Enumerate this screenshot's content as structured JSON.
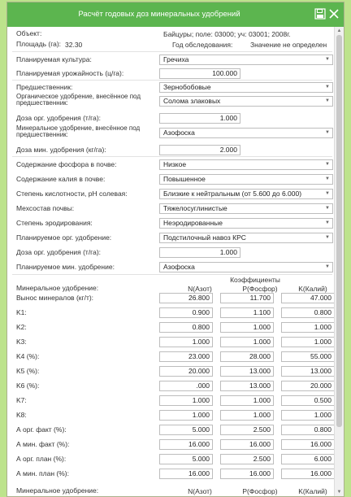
{
  "window": {
    "title": "Расчёт годовых доз минеральных удобрений"
  },
  "info": {
    "object_label": "Объект:",
    "object_value": "Байцуры; поле: 03000; уч: 03001; 2008г.",
    "area_label": "Площадь (га):",
    "area_value": "32.30",
    "survey_label": "Год обследования:",
    "survey_value": "Значение не определен"
  },
  "form": {
    "crop_label": "Планируемая культура:",
    "crop_value": "Гречиха",
    "yield_label": "Планируемая урожайность (ц/га):",
    "yield_value": "100.000",
    "pred_label": "Предшественник:",
    "pred_value": "Зернобобовые",
    "org_pred_label": "Органическое удобрение, внесённое под предшественник:",
    "org_pred_value": "Солома злаковых",
    "org_dose_label": "Доза орг. удобрения (т/га):",
    "org_dose_value": "1.000",
    "min_pred_label": "Минеральное удобрение, внесённое под предшественник:",
    "min_pred_value": "Азофоска",
    "min_dose_label": "Доза мин. удобрения (кг/га):",
    "min_dose_value": "2.000",
    "phos_label": "Содержание фосфора в почве:",
    "phos_value": "Низкое",
    "pot_label": "Содержание калия в почве:",
    "pot_value": "Повышенное",
    "ph_label": "Степень кислотности, pH солевая:",
    "ph_value": "Близкие к нейтральным (от 5.600 до 6.000)",
    "mech_label": "Мехсостав почвы:",
    "mech_value": "Тяжелосуглинистые",
    "eros_label": "Степень эродирования:",
    "eros_value": "Неэродированные",
    "plan_org_label": "Планируемое орг. удобрение:",
    "plan_org_value": "Подстилочный навоз КРС",
    "plan_org_dose_label": "Доза орг. удобрения (т/га):",
    "plan_org_dose_value": "1.000",
    "plan_min_label": "Планируемое мин. удобрение:",
    "plan_min_value": "Азофоска"
  },
  "coef": {
    "group_header": "Коэффициенты",
    "row_header": "Минеральное удобрение:",
    "col_n": "N(Азот)",
    "col_p": "P(Фосфор)",
    "col_k": "K(Калий)",
    "rows": [
      {
        "label": "Вынос минералов (кг/т):",
        "n": "26.800",
        "p": "11.700",
        "k": "47.000"
      },
      {
        "label": "K1:",
        "n": "0.900",
        "p": "1.100",
        "k": "0.800"
      },
      {
        "label": "K2:",
        "n": "0.800",
        "p": "1.000",
        "k": "1.000"
      },
      {
        "label": "K3:",
        "n": "1.000",
        "p": "1.000",
        "k": "1.000"
      },
      {
        "label": "K4 (%):",
        "n": "23.000",
        "p": "28.000",
        "k": "55.000"
      },
      {
        "label": "K5 (%):",
        "n": "20.000",
        "p": "13.000",
        "k": "13.000"
      },
      {
        "label": "K6 (%):",
        "n": ".000",
        "p": "13.000",
        "k": "20.000"
      },
      {
        "label": "K7:",
        "n": "1.000",
        "p": "1.000",
        "k": "0.500"
      },
      {
        "label": "K8:",
        "n": "1.000",
        "p": "1.000",
        "k": "1.000"
      },
      {
        "label": "А орг. факт (%):",
        "n": "5.000",
        "p": "2.500",
        "k": "0.800"
      },
      {
        "label": "А мин. факт (%):",
        "n": "16.000",
        "p": "16.000",
        "k": "16.000"
      },
      {
        "label": "А орг. план (%):",
        "n": "5.000",
        "p": "2.500",
        "k": "6.000"
      },
      {
        "label": "А мин. план (%):",
        "n": "16.000",
        "p": "16.000",
        "k": "16.000"
      }
    ],
    "footer_label": "Минеральное удобрение:",
    "footer_n": "N(Азот)",
    "footer_p": "P(Фосфор)",
    "footer_k": "K(Калий)"
  }
}
